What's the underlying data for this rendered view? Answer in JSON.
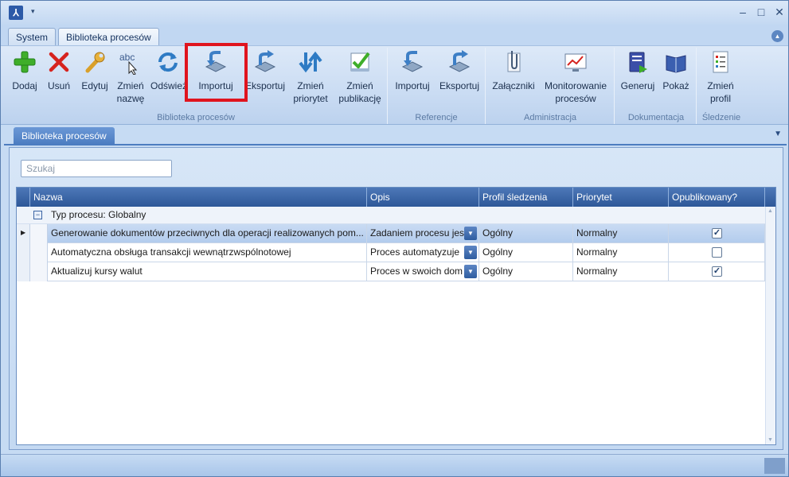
{
  "window": {
    "minimize": "–",
    "maximize": "□",
    "close": "✕"
  },
  "ribbon_tabs": [
    "System",
    "Biblioteka procesów"
  ],
  "ribbon": {
    "groups": [
      {
        "label": "Biblioteka procesów",
        "buttons": [
          {
            "label": "Dodaj"
          },
          {
            "label": "Usuń"
          },
          {
            "label": "Edytuj"
          },
          {
            "label": "Zmień nazwę"
          },
          {
            "label": "Odśwież"
          },
          {
            "label": "Importuj"
          },
          {
            "label": "Eksportuj"
          },
          {
            "label": "Zmień priorytet"
          },
          {
            "label": "Zmień publikację"
          }
        ]
      },
      {
        "label": "Referencje",
        "buttons": [
          {
            "label": "Importuj"
          },
          {
            "label": "Eksportuj"
          }
        ]
      },
      {
        "label": "Administracja",
        "buttons": [
          {
            "label": "Załączniki"
          },
          {
            "label": "Monitorowanie procesów"
          }
        ]
      },
      {
        "label": "Dokumentacja",
        "buttons": [
          {
            "label": "Generuj"
          },
          {
            "label": "Pokaż"
          }
        ]
      },
      {
        "label": "Śledzenie",
        "buttons": [
          {
            "label": "Zmień profil"
          }
        ]
      }
    ]
  },
  "document_tab": "Biblioteka procesów",
  "search": {
    "placeholder": "Szukaj",
    "value": ""
  },
  "grid": {
    "columns": [
      "Nazwa",
      "Opis",
      "Profil śledzenia",
      "Priorytet",
      "Opublikowany?"
    ],
    "group": "Typ procesu: Globalny",
    "rows": [
      {
        "name": "Generowanie dokumentów przeciwnych dla operacji realizowanych pom...",
        "desc": "Zadaniem procesu jes",
        "profile": "Ogólny",
        "priority": "Normalny",
        "published": true,
        "selected": true
      },
      {
        "name": "Automatyczna obsługa transakcji wewnątrzwspólnotowej",
        "desc": "Proces automatyzuje",
        "profile": "Ogólny",
        "priority": "Normalny",
        "published": false,
        "selected": false
      },
      {
        "name": "Aktualizuj kursy walut",
        "desc": "Proces w swoich dom",
        "profile": "Ogólny",
        "priority": "Normalny",
        "published": true,
        "selected": false
      }
    ]
  },
  "colors": {
    "accent": "#2d5798",
    "highlight": "#e0141e"
  }
}
